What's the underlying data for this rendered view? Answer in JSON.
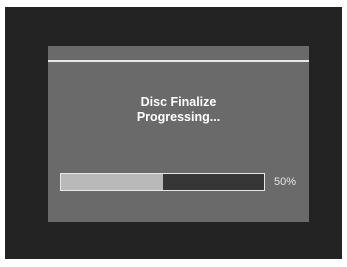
{
  "dialog": {
    "message_line1": "Disc Finalize",
    "message_line2": "Progressing...",
    "progress_text": "50%",
    "progress_fraction": 0.5
  },
  "colors": {
    "screen_background": "#232323",
    "dialog_background": "#6a6a6a",
    "progress_fill": "#b9b9b9",
    "progress_track": "#363636",
    "text": "#ffffff"
  }
}
